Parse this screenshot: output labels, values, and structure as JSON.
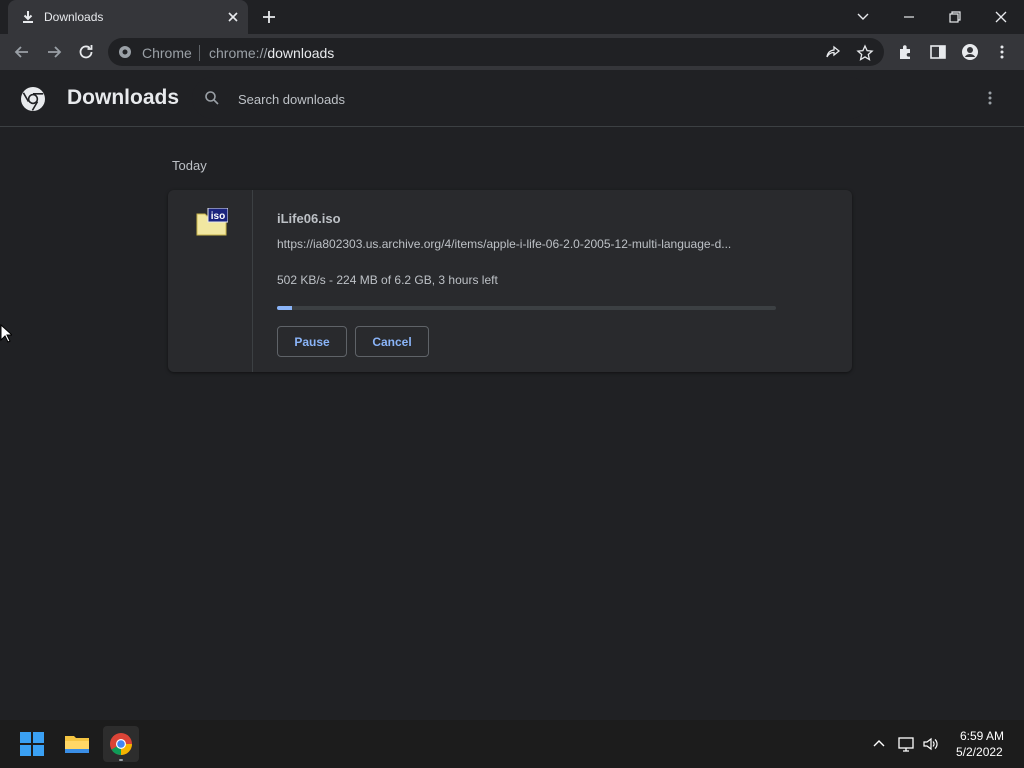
{
  "browser": {
    "tab": {
      "title": "Downloads",
      "icon": "download-icon"
    },
    "omnibox": {
      "scheme_label": "Chrome",
      "url_prefix": "chrome://",
      "url_path": "downloads"
    }
  },
  "page": {
    "title": "Downloads",
    "search": {
      "placeholder": "Search downloads"
    }
  },
  "downloads": {
    "section_label": "Today",
    "item": {
      "file_icon": "iso-file-icon",
      "file_icon_label": "iso",
      "filename": "iLife06.iso",
      "url": "https://ia802303.us.archive.org/4/items/apple-i-life-06-2.0-2005-12-multi-language-d...",
      "status": "502 KB/s - 224 MB of 6.2 GB, 3 hours left",
      "progress_fraction": 0.03,
      "pause_label": "Pause",
      "cancel_label": "Cancel"
    }
  },
  "taskbar": {
    "apps": [
      "start-icon",
      "file-explorer-icon",
      "chrome-icon"
    ],
    "clock": {
      "time": "6:59 AM",
      "date": "5/2/2022"
    }
  },
  "colors": {
    "background": "#202124",
    "toolbar": "#35363a",
    "card": "#292a2d",
    "accent": "#8ab4f8",
    "taskbar": "#1c1c1c"
  }
}
